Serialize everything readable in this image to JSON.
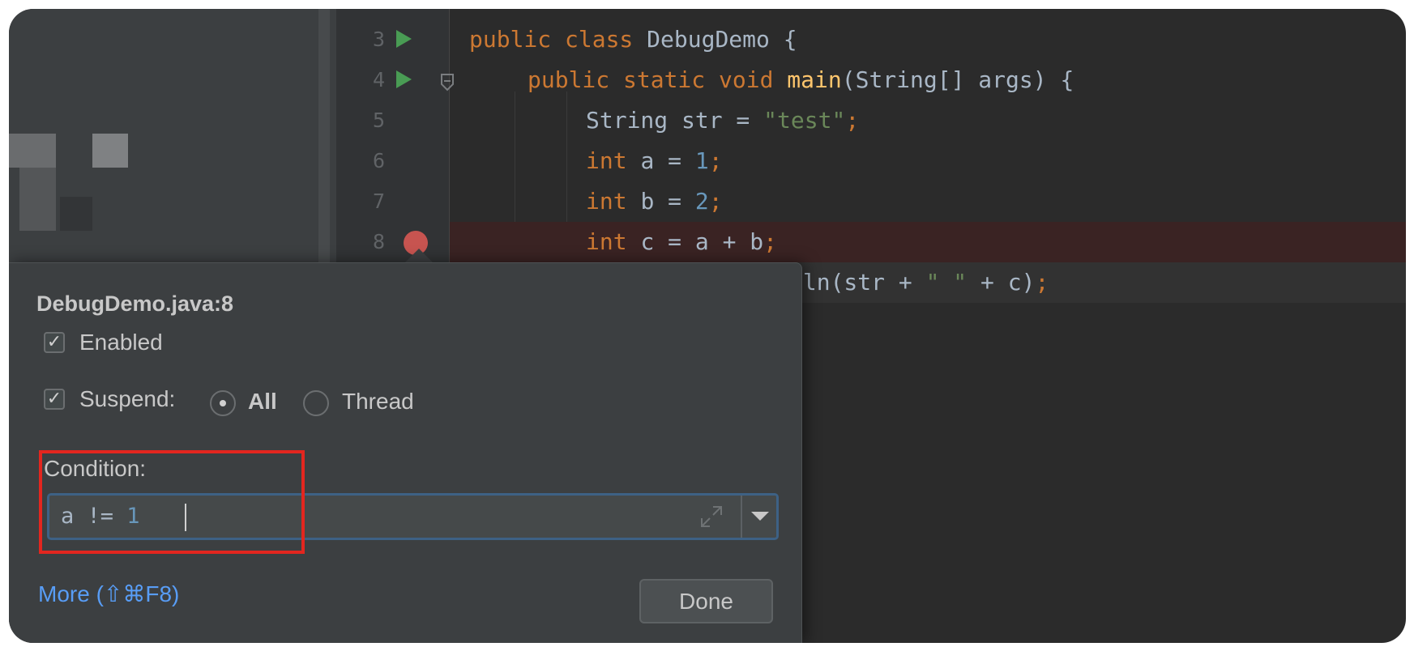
{
  "editor": {
    "line_numbers": [
      "3",
      "4",
      "5",
      "6",
      "7",
      "8"
    ],
    "lines": [
      {
        "tokens": [
          {
            "t": "public class ",
            "c": "kw"
          },
          {
            "t": "DebugDemo {",
            "c": ""
          }
        ]
      },
      {
        "tokens": [
          {
            "t": "public static void ",
            "c": "kw"
          },
          {
            "t": "main",
            "c": "fn"
          },
          {
            "t": "(String[] args) {",
            "c": ""
          }
        ]
      },
      {
        "tokens": [
          {
            "t": "String str = ",
            "c": ""
          },
          {
            "t": "\"test\"",
            "c": "str"
          },
          {
            "t": ";",
            "c": "kw"
          }
        ]
      },
      {
        "tokens": [
          {
            "t": "int ",
            "c": "kw"
          },
          {
            "t": "a = ",
            "c": ""
          },
          {
            "t": "1",
            "c": "num"
          },
          {
            "t": ";",
            "c": "kw"
          }
        ]
      },
      {
        "tokens": [
          {
            "t": "int ",
            "c": "kw"
          },
          {
            "t": "b = ",
            "c": ""
          },
          {
            "t": "2",
            "c": "num"
          },
          {
            "t": ";",
            "c": "kw"
          }
        ]
      },
      {
        "tokens": [
          {
            "t": "int ",
            "c": "kw"
          },
          {
            "t": "c = a + b",
            "c": ""
          },
          {
            "t": ";",
            "c": "kw"
          }
        ]
      },
      {
        "tokens": [
          {
            "t": "tln(str + ",
            "c": ""
          },
          {
            "t": "\" \"",
            "c": "str"
          },
          {
            "t": " + c)",
            "c": ""
          },
          {
            "t": ";",
            "c": "kw"
          }
        ]
      }
    ]
  },
  "breakpoint_popup": {
    "title": "DebugDemo.java:8",
    "enabled_label": "Enabled",
    "enabled_checked": true,
    "suspend_label": "Suspend:",
    "suspend_checked": true,
    "suspend_options": [
      "All",
      "Thread"
    ],
    "suspend_selected": "All",
    "condition_label": "Condition:",
    "condition_value": "a != 1",
    "more_link": "More (⇧⌘F8)",
    "done_label": "Done"
  },
  "colors": {
    "keyword": "#cc7832",
    "function": "#ffc66d",
    "string": "#6a8759",
    "number": "#6897bb",
    "breakpoint": "#c75450",
    "highlight_box": "#e3261f",
    "link": "#589df6"
  },
  "icons": [
    "run-icon",
    "fold-icon",
    "breakpoint-icon",
    "expand-icon",
    "chevron-down-icon",
    "checkbox-icon",
    "radio-icon"
  ]
}
